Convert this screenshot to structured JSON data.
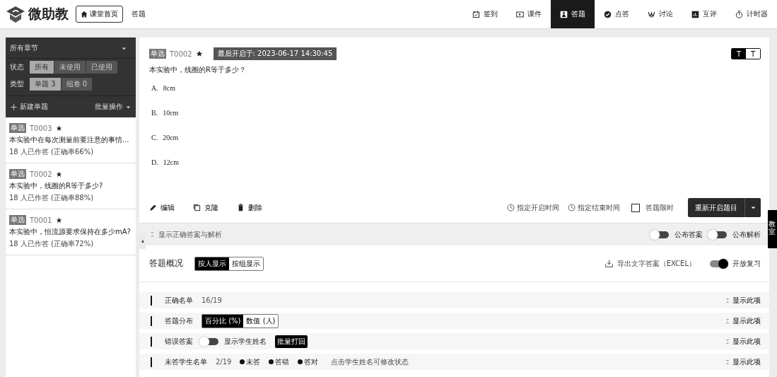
{
  "brand": {
    "name": "微助教"
  },
  "home_button": "课堂首页",
  "page_title": "答题",
  "nav": [
    {
      "label": "签到",
      "selected": false
    },
    {
      "label": "课件",
      "selected": false
    },
    {
      "label": "答题",
      "selected": true
    },
    {
      "label": "点答",
      "selected": false
    },
    {
      "label": "讨论",
      "selected": false
    },
    {
      "label": "互评",
      "selected": false
    },
    {
      "label": "计时器",
      "selected": false
    }
  ],
  "sidebar": {
    "chapter": "所有章节",
    "filters": [
      {
        "label": "状态",
        "options": [
          {
            "label": "所有",
            "selected": true
          },
          {
            "label": "未使用",
            "selected": false
          },
          {
            "label": "已使用",
            "selected": false
          }
        ]
      },
      {
        "label": "类型",
        "options": [
          {
            "label": "单题 3",
            "selected": true
          },
          {
            "label": "组卷 0",
            "selected": false
          }
        ]
      }
    ],
    "new_button": "新建单题",
    "batch_button": "批量操作",
    "items": [
      {
        "tag": "单选",
        "code": "T0003",
        "title": "本实验中在每次测量前要注意的事情...",
        "stats": "18 人已作答 (正确率66%)"
      },
      {
        "tag": "单选",
        "code": "T0002",
        "title": "本实验中，线圈的R等于多少?",
        "stats": "18 人已作答 (正确率88%)"
      },
      {
        "tag": "单选",
        "code": "T0001",
        "title": "本实验中，恒流源要求保持在多少mA?",
        "stats": "18 人已作答 (正确率72%)"
      }
    ]
  },
  "question": {
    "tag": "单选",
    "code": "T0002",
    "opened": "最后开启于: 2023-06-17 14:30:45",
    "font_toggle": [
      {
        "label": "T",
        "selected": true
      },
      {
        "label": "T",
        "selected": false
      }
    ],
    "text": "本实验中，线圈的R等于多少？",
    "options": [
      {
        "letter": "A.",
        "text": "8cm"
      },
      {
        "letter": "B.",
        "text": "10cm"
      },
      {
        "letter": "C.",
        "text": "20cm"
      },
      {
        "letter": "D.",
        "text": "12cm"
      }
    ],
    "actions": [
      "编辑",
      "克隆",
      "删除"
    ],
    "start_time": "指定开启时间",
    "end_time": "指定结束时间",
    "time_limit": {
      "label": "答题限时",
      "checked": false
    },
    "reopen_button": "重新开启题目"
  },
  "answer_bar": {
    "show_label": "显示正确答案与解析",
    "toggles": [
      {
        "label": "公布答案",
        "on": false
      },
      {
        "label": "公布解析",
        "on": false
      }
    ]
  },
  "overview": {
    "title": "答题概况",
    "views": [
      {
        "label": "按人显示",
        "selected": true
      },
      {
        "label": "按组显示",
        "selected": false
      }
    ],
    "export": "导出文字答案（EXCEL）",
    "review": {
      "label": "开放复习",
      "on": true
    }
  },
  "sections": [
    {
      "kind": "count",
      "title": "正确名单",
      "value": "16/19",
      "more": "显示此项"
    },
    {
      "kind": "segment",
      "title": "答题分布",
      "options": [
        {
          "label": "百分比 (%)",
          "selected": true
        },
        {
          "label": "数值 (人)",
          "selected": false
        }
      ],
      "more": "显示此项"
    },
    {
      "kind": "wrong",
      "title": "错误答案",
      "toggle": {
        "label": "显示学生姓名",
        "on": false
      },
      "button": "批量打回",
      "more": "显示此项"
    },
    {
      "kind": "unanswered",
      "title": "未答学生名单",
      "value": "2/19",
      "legend": [
        "未答",
        "答错",
        "答对"
      ],
      "hint": "点击学生姓名可修改状态",
      "more": "显示此项"
    }
  ],
  "side_tab": "教室"
}
